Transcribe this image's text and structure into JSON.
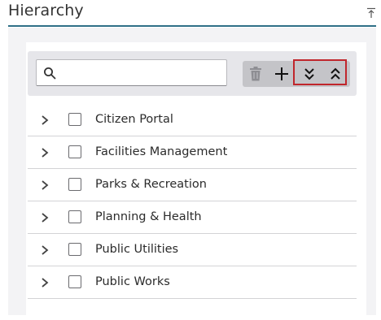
{
  "panel": {
    "title": "Hierarchy"
  },
  "search": {
    "value": "",
    "placeholder": ""
  },
  "toolbar": {
    "delete_icon": "trash-icon",
    "add_icon": "plus-icon",
    "expand_icon": "double-chevron-down-icon",
    "collapse_icon": "double-chevron-up-icon",
    "highlight_color": "#c0262c"
  },
  "tree": {
    "items": [
      {
        "label": "Citizen Portal"
      },
      {
        "label": "Facilities Management"
      },
      {
        "label": "Parks & Recreation"
      },
      {
        "label": "Planning & Health"
      },
      {
        "label": "Public Utilities"
      },
      {
        "label": "Public Works"
      }
    ]
  },
  "colors": {
    "accent_line": "#2f6f87",
    "panel_bg": "#f3f3f5",
    "toolbar_bg": "#e6e6ea"
  }
}
